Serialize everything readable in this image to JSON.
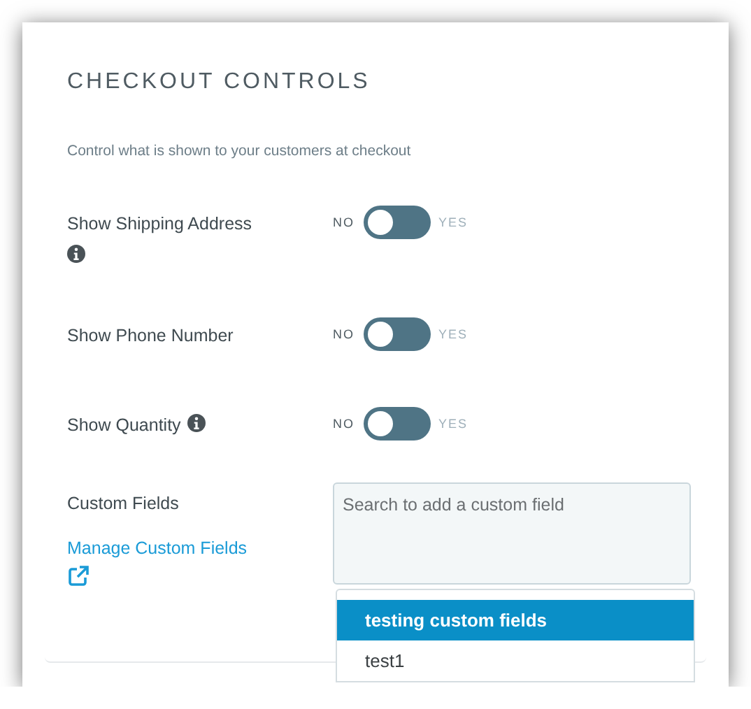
{
  "panel": {
    "title": "CHECKOUT CONTROLS",
    "subtitle": "Control what is shown to your customers at checkout"
  },
  "toggles": [
    {
      "label": "Show Shipping Address",
      "info_icon": true,
      "off_label": "NO",
      "on_label": "YES",
      "on": false
    },
    {
      "label": "Show Phone Number",
      "info_icon": false,
      "off_label": "NO",
      "on_label": "YES",
      "on": false
    },
    {
      "label": "Show Quantity",
      "info_icon": true,
      "off_label": "NO",
      "on_label": "YES",
      "on": false
    }
  ],
  "custom_fields": {
    "label": "Custom Fields",
    "link": "Manage Custom Fields",
    "search": {
      "placeholder": "Search to add a custom field"
    },
    "options": [
      {
        "label": "testing custom fields",
        "selected": true
      },
      {
        "label": "test1",
        "selected": false
      }
    ]
  }
}
